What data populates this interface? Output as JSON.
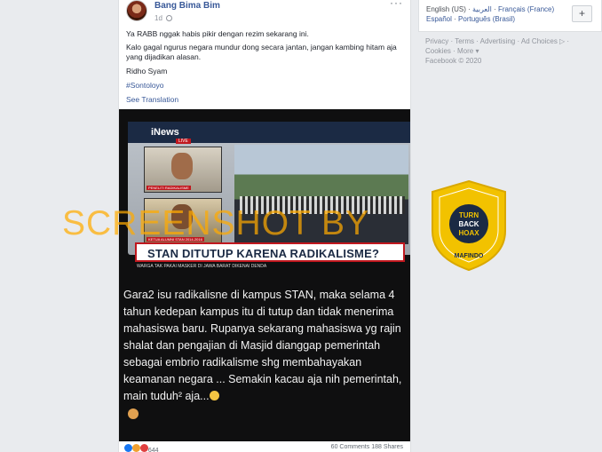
{
  "post": {
    "author": "Bang Bima Bim",
    "time": "1d",
    "more": "···",
    "line1": "Ya RABB nggak habis pikir dengan rezim sekarang ini.",
    "line2": "Kalo gagal ngurus negara mundur dong secara jantan, jangan kambing hitam aja yang dijadikan alasan.",
    "line3": "Ridho Syam",
    "hashtag": "#Sontoloyo",
    "see_translation": "See Translation",
    "reactions_count": "644",
    "stats": "60 Comments  188 Shares"
  },
  "media": {
    "channel": "iNews",
    "live": "LIVE",
    "caption1": "PENELITI RADIKALISME",
    "caption2": "KETUA ALUMNI STAN 2014-2016",
    "headline": "STAN DITUTUP KARENA RADIKALISME?",
    "ticker": "WARGA TAK PAKAI MASKER DI JAWA BARAT DIKENAI DENDA",
    "overlay_text": "Gara2 isu radikalisne di kampus STAN, maka selama 4 tahun kedepan kampus itu di tutup dan tidak menerima mahasiswa baru. Rupanya sekarang  mahasiswa yg rajin shalat dan pengajian di Masjid dianggap pemerintah sebagai embrio radikalisme shg membahayakan keamanan negara ... Semakin kacau aja nih pemerintah, main tuduh² aja..."
  },
  "sidebar": {
    "lang1": "English (US)",
    "lang2": "العربية",
    "lang3": "Français (France)",
    "lang4": "Español",
    "lang5": "Português (Brasil)",
    "plus": "+",
    "f1": "Privacy",
    "f2": "Terms",
    "f3": "Advertising",
    "f4": "Ad Choices",
    "f5": "Cookies",
    "f6": "More",
    "copyright": "Facebook © 2020"
  },
  "watermark": {
    "text": "SCREENSHOT BY",
    "badge_ring": "MASYARAKAT ANTI FITNAH INDONESIA",
    "badge_center1": "TURN",
    "badge_center2": "BACK",
    "badge_center3": "HOAX",
    "badge_bottom": "MAFINDO"
  },
  "colors": {
    "link": "#385898",
    "watermark": "#ffaa00",
    "badge": "#f2c200",
    "headline_red": "#c0171e"
  }
}
